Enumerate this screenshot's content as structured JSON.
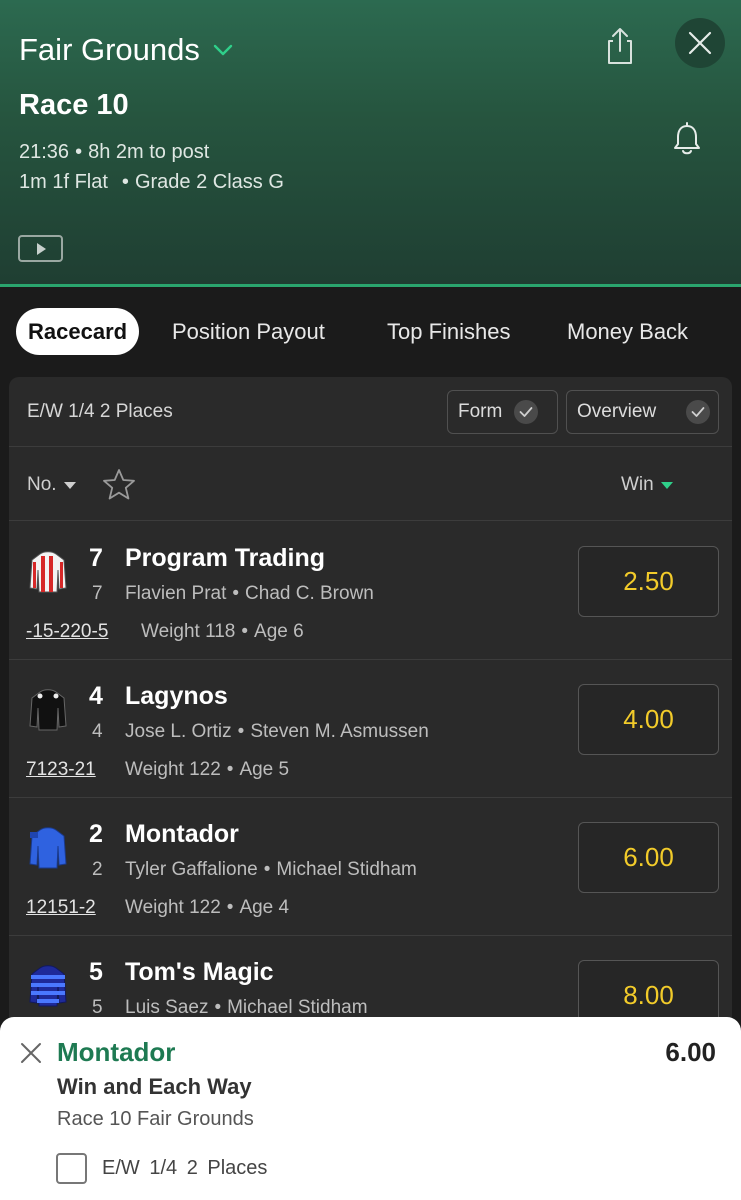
{
  "header": {
    "venue": "Fair Grounds",
    "race": "Race 10",
    "time": "21:36",
    "countdown": "8h 2m to post",
    "distance": "1m 1f Flat",
    "grade": "Grade 2 Class G"
  },
  "tabs": [
    "Racecard",
    "Position Payout",
    "Top Finishes",
    "Money Back"
  ],
  "market": {
    "ew_terms": "E/W 1/4 2 Places",
    "form_chip": "Form",
    "overview_chip": "Overview",
    "no_sort": "No.",
    "win_sort": "Win"
  },
  "runners": [
    {
      "num": "7",
      "name": "Program Trading",
      "jockey": "Flavien Prat",
      "trainer": "Chad C. Brown",
      "form": "-15-220-5",
      "weight": "Weight 118",
      "age": "Age 6",
      "odds": "2.50"
    },
    {
      "num": "4",
      "name": "Lagynos",
      "jockey": "Jose L. Ortiz",
      "trainer": "Steven M. Asmussen",
      "form": "7123-21",
      "weight": "Weight 122",
      "age": "Age 5",
      "odds": "4.00"
    },
    {
      "num": "2",
      "name": "Montador",
      "jockey": "Tyler Gaffalione",
      "trainer": "Michael Stidham",
      "form": "12151-2",
      "weight": "Weight 122",
      "age": "Age 4",
      "odds": "6.00"
    },
    {
      "num": "5",
      "name": "Tom's Magic",
      "jockey": "Luis Saez",
      "trainer": "Michael Stidham",
      "form": "",
      "weight": "",
      "age": "",
      "odds": "8.00"
    }
  ],
  "betslip": {
    "selection": "Montador",
    "odds": "6.00",
    "market": "Win and Each Way",
    "event": "Race 10 Fair Grounds",
    "ew_label": "E/W 1/4 2 Places",
    "ew_checked": false
  },
  "colors": {
    "accent_green": "#2fd08a",
    "odds_yellow": "#f2cb2a",
    "selection_green": "#1e7a52"
  }
}
